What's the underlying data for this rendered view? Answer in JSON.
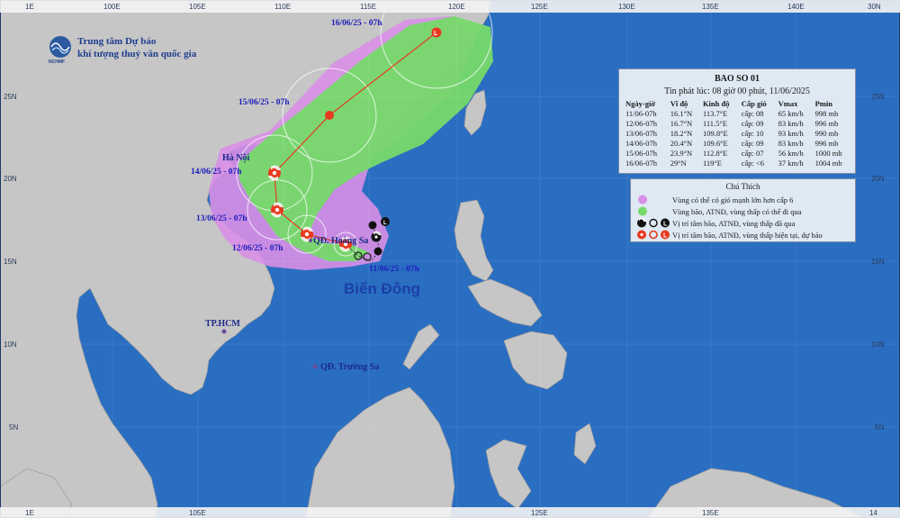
{
  "map": {
    "lon_ticks": [
      "100E",
      "105E",
      "110E",
      "115E",
      "120E",
      "125E",
      "130E",
      "135E",
      "140E"
    ],
    "lat_ticks": [
      "25N",
      "20N",
      "15N",
      "10N",
      "5N"
    ],
    "corner_left_top": "1E",
    "corner_right_top": "30N",
    "corner_left_bottom": "1E",
    "corner_right_bottom": "14",
    "sea_label": "Biển Đông",
    "places": {
      "hanoi": "Hà Nội",
      "hoang_sa": "QĐ. Hoàng Sa",
      "hcm": "TP.HCM",
      "truong_sa": "QĐ. Trường Sa"
    },
    "colors": {
      "ocean": "#2a6ec2",
      "land": "#c6c6c6",
      "risk_zone": "#d88fe6",
      "storm_zone": "#76d96a",
      "track": "#e8391e"
    },
    "track_labels": [
      "16/06/25 - 07h",
      "15/06/25 - 07h",
      "14/06/25 - 07h",
      "13/06/25 - 07h",
      "12/06/25 - 07h",
      "11/06/25 - 07h"
    ]
  },
  "org": {
    "line1": "Trung tâm Dự báo",
    "line2": "khí tượng thuỷ văn quốc gia",
    "logo_text": "NCHMF"
  },
  "bulletin": {
    "title": "BAO SO 01",
    "issued": "Tin phát lúc: 08 giờ 00 phút, 11/06/2025",
    "headers": [
      "Ngày-giờ",
      "Vĩ độ",
      "Kinh độ",
      "Cấp gió",
      "Vmax",
      "Pmin"
    ],
    "rows": [
      [
        "11/06-07h",
        "16.1°N",
        "113.7°E",
        "cấp: 08",
        "65 km/h",
        "998 mb"
      ],
      [
        "12/06-07h",
        "16.7°N",
        "111.5°E",
        "cấp: 09",
        "83 km/h",
        "996 mb"
      ],
      [
        "13/06-07h",
        "18.2°N",
        "109.8°E",
        "cấp: 10",
        "93 km/h",
        "990 mb"
      ],
      [
        "14/06-07h",
        "20.4°N",
        "109.6°E",
        "cấp: 09",
        "83 km/h",
        "996 mb"
      ],
      [
        "15/06-07h",
        "23.9°N",
        "112.8°E",
        "cấp: 07",
        "56 km/h",
        "1000 mb"
      ],
      [
        "16/06-07h",
        "29°N",
        "119°E",
        "cấp: <6",
        "37 km/h",
        "1004 mb"
      ]
    ]
  },
  "legend": {
    "title": "Chú Thích",
    "items": [
      {
        "text": "Vùng có thể có gió mạnh lớn hơn cấp 6",
        "icon": "purple-dot-icon"
      },
      {
        "text": "Vùng bão, ATNĐ, vùng thấp có thể đi qua",
        "icon": "green-dot-icon"
      },
      {
        "text": "Vị trí tâm bão, ATNĐ, vùng thấp đã qua",
        "icon": "past-position-icons"
      },
      {
        "text": "Vị trí tâm bão, ATNĐ, vùng thấp hiện tại, dự báo",
        "icon": "forecast-position-icons"
      }
    ]
  }
}
